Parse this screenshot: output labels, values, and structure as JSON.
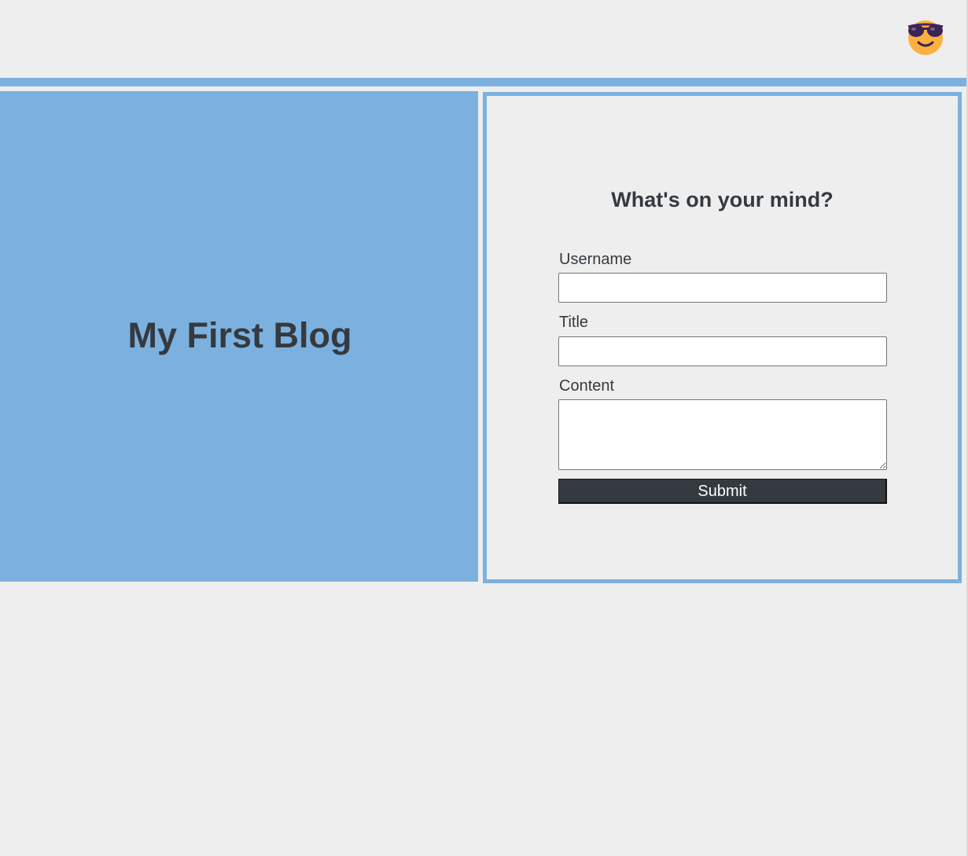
{
  "header": {
    "toggle_icon": "sunglasses-face-icon",
    "accent_color": "#7cb1df"
  },
  "hero": {
    "title": "My First Blog"
  },
  "form": {
    "heading": "What's on your mind?",
    "username_label": "Username",
    "username_value": "",
    "title_label": "Title",
    "title_value": "",
    "content_label": "Content",
    "content_value": "",
    "submit_label": "Submit"
  },
  "colors": {
    "background": "#eeeeee",
    "accent": "#7cb1df",
    "text": "#343a40",
    "button": "#343a40"
  }
}
